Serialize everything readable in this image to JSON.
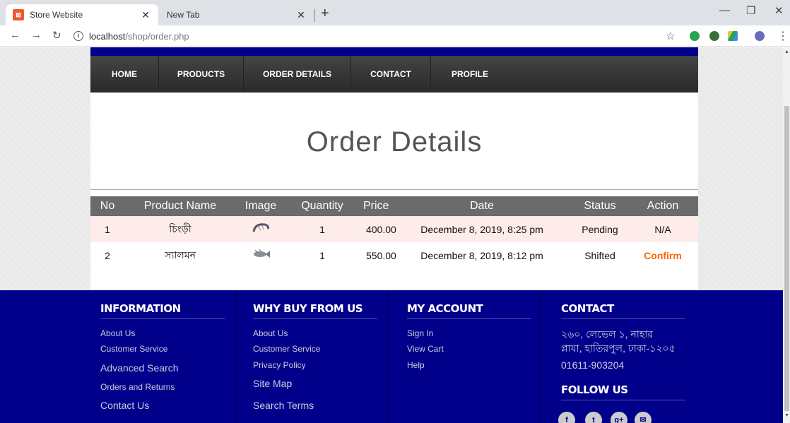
{
  "browser": {
    "tabs": [
      {
        "title": "Store Website",
        "favicon": "xampp-icon"
      },
      {
        "title": "New Tab"
      }
    ],
    "url_host": "localhost",
    "url_path": "/shop/order.php"
  },
  "nav": {
    "items": [
      "HOME",
      "PRODUCTS",
      "ORDER DETAILS",
      "CONTACT",
      "PROFILE"
    ]
  },
  "page": {
    "title": "Order Details"
  },
  "table": {
    "headers": [
      "No",
      "Product Name",
      "Image",
      "Quantity",
      "Price",
      "Date",
      "Status",
      "Action"
    ],
    "rows": [
      {
        "no": "1",
        "product": "চিংড়ী",
        "quantity": "1",
        "price": "400.00",
        "date": "December 8, 2019, 8:25 pm",
        "status": "Pending",
        "action": "N/A"
      },
      {
        "no": "2",
        "product": "স্যালমন",
        "quantity": "1",
        "price": "550.00",
        "date": "December 8, 2019, 8:12 pm",
        "status": "Shifted",
        "action": "Confirm"
      }
    ]
  },
  "footer": {
    "information": {
      "title": "INFORMATION",
      "links": [
        "About Us",
        "Customer Service",
        "Advanced Search",
        "Orders and Returns",
        "Contact Us"
      ]
    },
    "why_buy": {
      "title": "WHY BUY FROM US",
      "links": [
        "About Us",
        "Customer Service",
        "Privacy Policy",
        "Site Map",
        "Search Terms"
      ]
    },
    "my_account": {
      "title": "MY ACCOUNT",
      "links": [
        "Sign In",
        "View Cart",
        "Help"
      ]
    },
    "contact": {
      "title": "CONTACT",
      "address_line1": "২৬০, লেভেল ১, নাহার",
      "address_line2": "প্লাযা, হাতিরপুল, ঢাকা-১২০৫",
      "phone": "01611-903204",
      "follow_title": "FOLLOW US",
      "social": [
        "f",
        "t",
        "g+",
        "✉"
      ]
    }
  },
  "colors": {
    "footer_bg": "#00008b",
    "confirm": "#ff6600",
    "navbar": "#333333"
  }
}
